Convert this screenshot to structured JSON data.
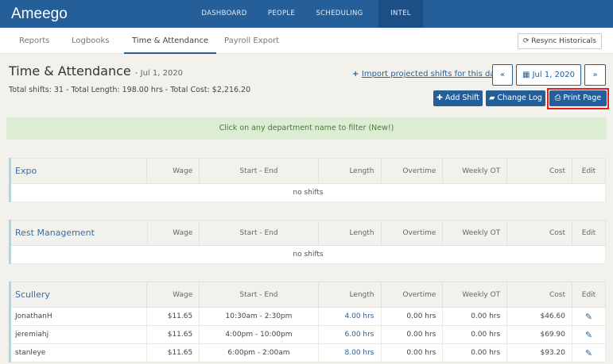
{
  "app": {
    "logo": "Ameego"
  },
  "nav": [
    {
      "label": "DASHBOARD"
    },
    {
      "label": "PEOPLE"
    },
    {
      "label": "SCHEDULING"
    },
    {
      "label": "INTEL",
      "active": true
    }
  ],
  "subnav": [
    {
      "label": "Reports"
    },
    {
      "label": "Logbooks"
    },
    {
      "label": "Time & Attendance",
      "active": true
    },
    {
      "label": "Payroll Export"
    }
  ],
  "resync_label": "Resync Historicals",
  "page": {
    "title": "Time & Attendance",
    "date_suffix": "- Jul 1, 2020",
    "totals": "Total shifts: 31 - Total Length: 198.00 hrs - Total Cost: $2,216.20",
    "import_link": "Import projected shifts for this day",
    "prev": "«",
    "date": "Jul 1, 2020",
    "next": "»"
  },
  "actions": {
    "add_shift": "Add Shift",
    "change_log": "Change Log",
    "print": "Print Page"
  },
  "alert": "Click on any department name to filter (New!)",
  "columns": [
    "Wage",
    "Start - End",
    "Length",
    "Overtime",
    "Weekly OT",
    "Cost",
    "Edit"
  ],
  "empty_text": "no shifts",
  "departments": [
    {
      "name": "Expo",
      "rows": []
    },
    {
      "name": "Rest Management",
      "rows": []
    },
    {
      "name": "Scullery",
      "rows": [
        {
          "name": "JonathanH",
          "wage": "$11.65",
          "time": "10:30am - 2:30pm",
          "length": "4.00 hrs",
          "ot": "0.00 hrs",
          "wot": "0.00 hrs",
          "cost": "$46.60"
        },
        {
          "name": "jeremiahj",
          "wage": "$11.65",
          "time": "4:00pm - 10:00pm",
          "length": "6.00 hrs",
          "ot": "0.00 hrs",
          "wot": "0.00 hrs",
          "cost": "$69.90"
        },
        {
          "name": "stanleye",
          "wage": "$11.65",
          "time": "6:00pm - 2:00am",
          "length": "8.00 hrs",
          "ot": "0.00 hrs",
          "wot": "0.00 hrs",
          "cost": "$93.20"
        }
      ]
    }
  ]
}
